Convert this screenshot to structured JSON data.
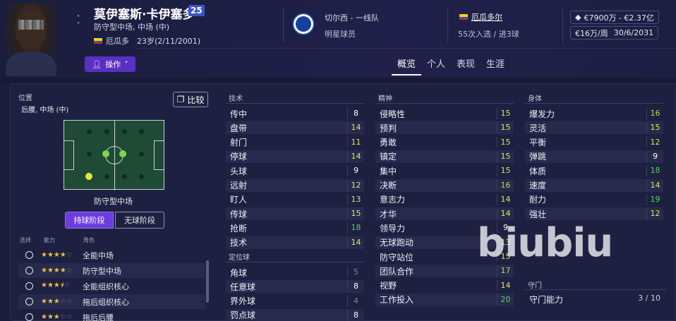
{
  "header": {
    "name": "莫伊塞斯·卡伊塞多",
    "number": "25",
    "positions": "防守型中场, 中场 (中)",
    "nationality": "厄瓜多",
    "age_dob": "23岁(2/11/2001)",
    "actions_label": "操作",
    "club_team": "切尔西 - 一线队",
    "club_status": "明星球员",
    "intl_nation": "厄瓜多尔",
    "intl_caps": "55次入选 / 进3球",
    "value": "€7900万 - €2.37亿",
    "wage": "€16万/周",
    "contract_end": "30/6/2031"
  },
  "tabs": [
    "概览",
    "个人",
    "表现",
    "生涯"
  ],
  "left": {
    "position_label": "位置",
    "position_value": "后腰, 中场 (中)",
    "compare_label": "比较",
    "role_name": "防守型中场",
    "phase_in": "持球阶段",
    "phase_out": "无球阶段",
    "col_select": "选择",
    "col_ability": "能力",
    "col_role": "角色",
    "roles": [
      {
        "stars": 4,
        "name": "全能中场"
      },
      {
        "stars": 4,
        "name": "防守型中场"
      },
      {
        "stars": 3.5,
        "name": "全能组织核心"
      },
      {
        "stars": 3,
        "name": "拖后组织核心"
      },
      {
        "stars": 3,
        "name": "拖后后腰"
      }
    ]
  },
  "technical": {
    "title": "技术",
    "attrs": [
      {
        "name": "传中",
        "value": "8",
        "color": "c-white"
      },
      {
        "name": "盘带",
        "value": "14",
        "color": "c-yellow"
      },
      {
        "name": "射门",
        "value": "11",
        "color": "c-yellow"
      },
      {
        "name": "停球",
        "value": "14",
        "color": "c-yellow"
      },
      {
        "name": "头球",
        "value": "9",
        "color": "c-white"
      },
      {
        "name": "远射",
        "value": "12",
        "color": "c-yellow"
      },
      {
        "name": "盯人",
        "value": "13",
        "color": "c-yellow"
      },
      {
        "name": "传球",
        "value": "15",
        "color": "c-yellow"
      },
      {
        "name": "抢断",
        "value": "18",
        "color": "c-green"
      },
      {
        "name": "技术",
        "value": "14",
        "color": "c-yellow"
      }
    ]
  },
  "set_pieces": {
    "title": "定位球",
    "attrs": [
      {
        "name": "角球",
        "value": "5",
        "color": "c-gray"
      },
      {
        "name": "任意球",
        "value": "8",
        "color": "c-white"
      },
      {
        "name": "界外球",
        "value": "4",
        "color": "c-gray"
      },
      {
        "name": "罚点球",
        "value": "8",
        "color": "c-white"
      }
    ]
  },
  "mental": {
    "title": "精神",
    "attrs": [
      {
        "name": "侵略性",
        "value": "15",
        "color": "c-yellow"
      },
      {
        "name": "预判",
        "value": "15",
        "color": "c-yellow"
      },
      {
        "name": "勇敢",
        "value": "15",
        "color": "c-yellow"
      },
      {
        "name": "镇定",
        "value": "15",
        "color": "c-yellow"
      },
      {
        "name": "集中",
        "value": "15",
        "color": "c-yellow"
      },
      {
        "name": "决断",
        "value": "16",
        "color": "c-lime"
      },
      {
        "name": "意志力",
        "value": "14",
        "color": "c-yellow"
      },
      {
        "name": "才华",
        "value": "14",
        "color": "c-yellow"
      },
      {
        "name": "领导力",
        "value": "9",
        "color": "c-white"
      },
      {
        "name": "无球跑动",
        "value": "13",
        "color": "c-yellow"
      },
      {
        "name": "防守站位",
        "value": "15",
        "color": "c-yellow"
      },
      {
        "name": "团队合作",
        "value": "17",
        "color": "c-lime"
      },
      {
        "name": "视野",
        "value": "14",
        "color": "c-yellow"
      },
      {
        "name": "工作投入",
        "value": "20",
        "color": "c-green"
      }
    ]
  },
  "physical": {
    "title": "身体",
    "attrs": [
      {
        "name": "爆发力",
        "value": "16",
        "color": "c-lime"
      },
      {
        "name": "灵活",
        "value": "15",
        "color": "c-yellow"
      },
      {
        "name": "平衡",
        "value": "12",
        "color": "c-yellow"
      },
      {
        "name": "弹跳",
        "value": "9",
        "color": "c-white"
      },
      {
        "name": "体质",
        "value": "18",
        "color": "c-green"
      },
      {
        "name": "速度",
        "value": "14",
        "color": "c-yellow"
      },
      {
        "name": "耐力",
        "value": "19",
        "color": "c-green"
      },
      {
        "name": "强壮",
        "value": "12",
        "color": "c-yellow"
      }
    ]
  },
  "goalkeeping": {
    "title": "守门",
    "name": "守门能力",
    "value": "3 / 10"
  },
  "watermark": "biubiu",
  "colors": {
    "accent": "#5a2fc4",
    "panel": "#1d2040",
    "background": "#1b1e3c"
  }
}
